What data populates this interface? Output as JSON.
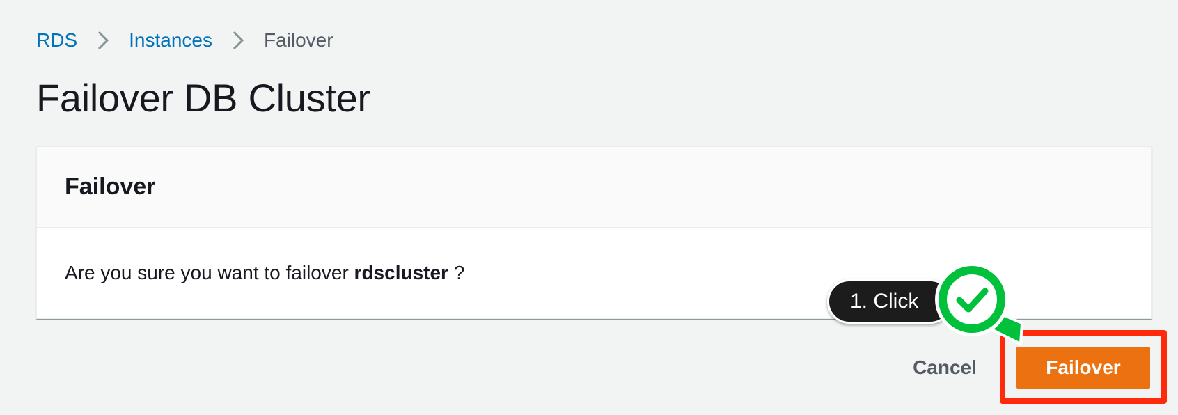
{
  "breadcrumb": {
    "items": [
      {
        "label": "RDS"
      },
      {
        "label": "Instances"
      },
      {
        "label": "Failover"
      }
    ]
  },
  "page": {
    "title": "Failover DB Cluster"
  },
  "panel": {
    "title": "Failover",
    "message_prefix": "Are you sure you want to failover",
    "cluster_name": "rdscluster",
    "message_suffix": "?"
  },
  "actions": {
    "cancel_label": "Cancel",
    "failover_label": "Failover"
  },
  "tutorial": {
    "callout_label": "1. Click"
  },
  "colors": {
    "primary_button": "#ec7211",
    "link": "#0073bb",
    "highlight": "#ff2a0a",
    "marker": "#00c03c"
  },
  "icons": [
    "chevron-right-icon",
    "checkmark-icon",
    "magnifier-icon"
  ]
}
